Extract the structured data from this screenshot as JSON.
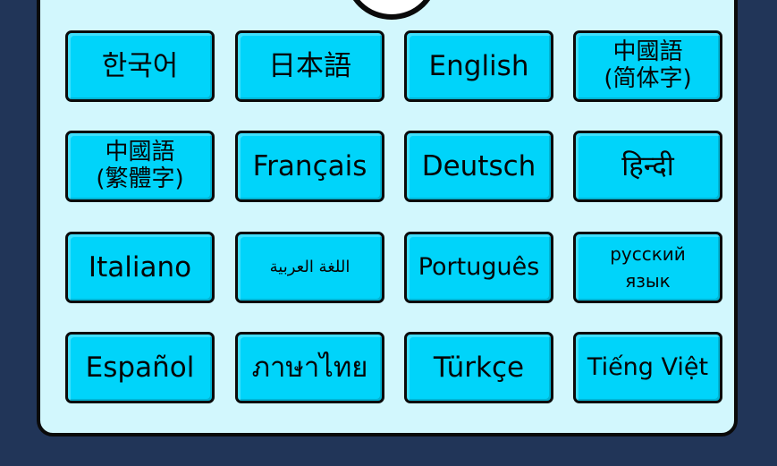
{
  "colors": {
    "background": "#213558",
    "panel": "#d2f7fd",
    "button": "#00d4fa",
    "border": "#0a0a0a"
  },
  "languages": [
    {
      "label": "한국어"
    },
    {
      "label": "日本語"
    },
    {
      "label": "English"
    },
    {
      "label": "中國語\n(简体字)"
    },
    {
      "label": "中國語\n(繁體字)"
    },
    {
      "label": "Français"
    },
    {
      "label": "Deutsch"
    },
    {
      "label": "हिन्दी"
    },
    {
      "label": "Italiano"
    },
    {
      "label": "اللغة العربية"
    },
    {
      "label": "Português"
    },
    {
      "label": "русский\nязык"
    },
    {
      "label": "Español"
    },
    {
      "label": "ภาษาไทย"
    },
    {
      "label": "Türkçe"
    },
    {
      "label": "Tiếng Việt"
    }
  ]
}
